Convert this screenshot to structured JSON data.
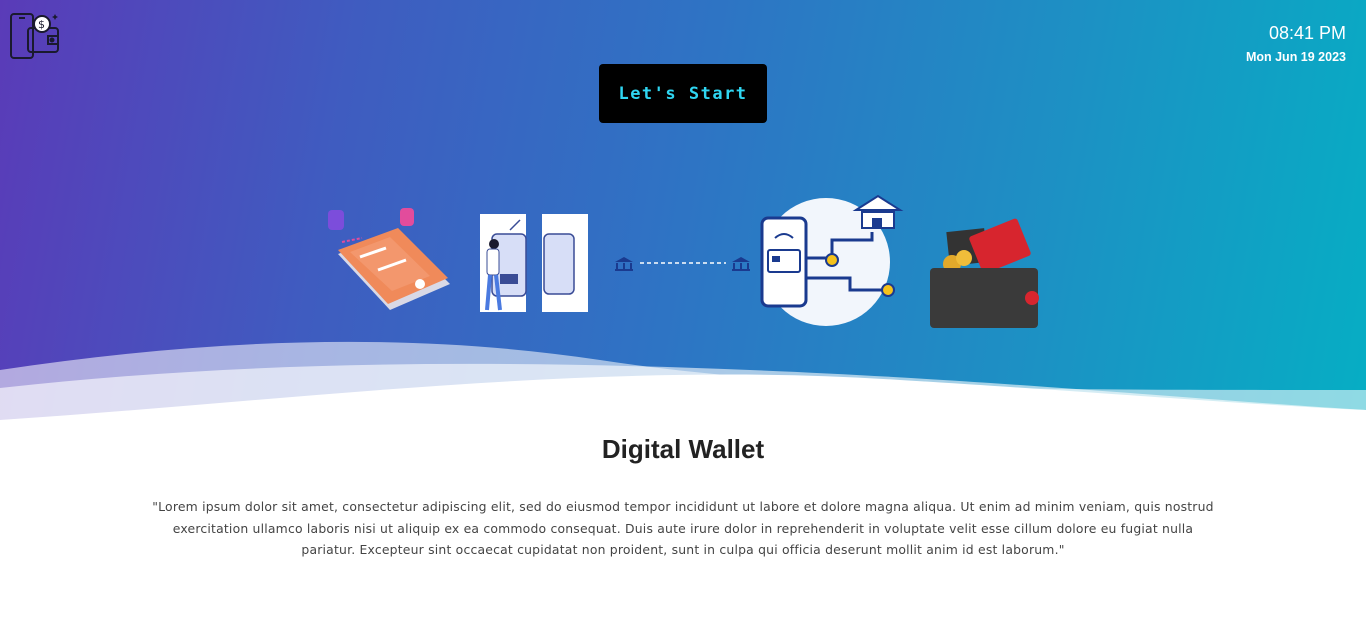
{
  "header": {
    "logo_icon": "wallet-phone-icon",
    "time": "08:41 PM",
    "date": "Mon Jun 19 2023"
  },
  "hero": {
    "start_button_label": "Let's Start",
    "gradient": [
      "#5a3bb8",
      "#06aec4"
    ],
    "illustration_icons": [
      "payment-phone-icon",
      "person-phone-icon",
      "bank-transfer-icon",
      "mobile-bank-icon",
      "wallet-card-icon"
    ]
  },
  "content": {
    "title": "Digital Wallet",
    "description": "\"Lorem ipsum dolor sit amet, consectetur adipiscing elit, sed do eiusmod tempor incididunt ut labore et dolore magna aliqua. Ut enim ad minim veniam, quis nostrud exercitation ullamco laboris nisi ut aliquip ex ea commodo consequat. Duis aute irure dolor in reprehenderit in voluptate velit esse cillum dolore eu fugiat nulla pariatur. Excepteur sint occaecat cupidatat non proident, sunt in culpa qui officia deserunt mollit anim id est laborum.\""
  }
}
